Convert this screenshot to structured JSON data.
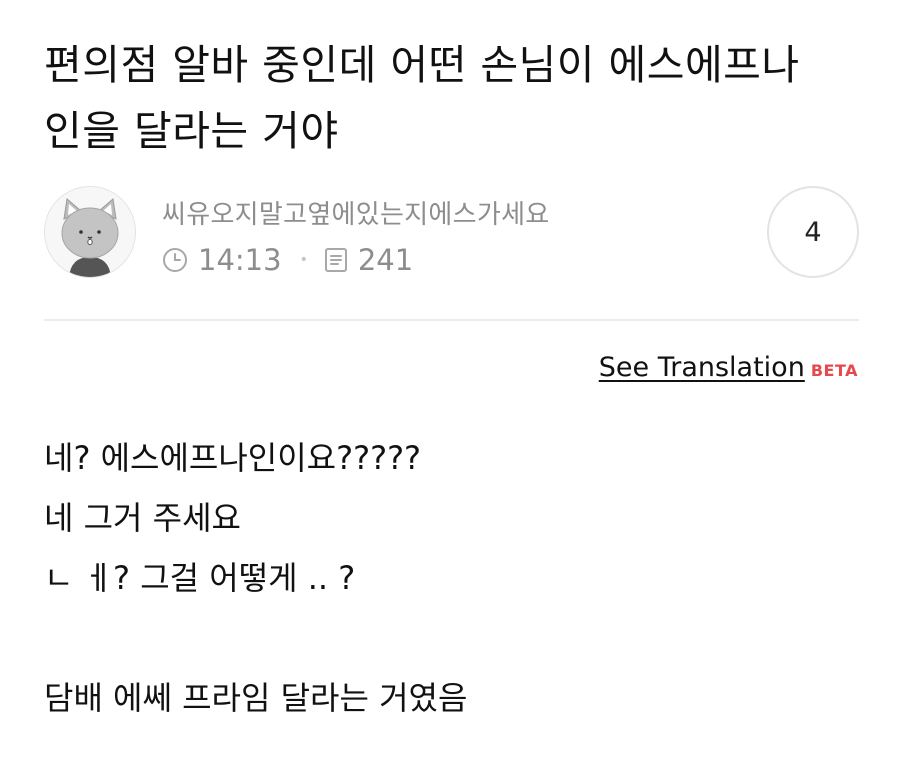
{
  "post": {
    "title": "편의점 알바 중인데 어떤 손님이 에스에프나\n인을 달라는 거야"
  },
  "author": {
    "nickname": "씨유오지말고옆에있는지에스가세요",
    "time": "14:13",
    "view_count": "241",
    "avatar_icon": "cat-avatar-icon"
  },
  "comments": {
    "count": "4"
  },
  "translation": {
    "link_label": "See Translation",
    "badge": "BETA",
    "badge_color": "#e5484d"
  },
  "body": {
    "lines": [
      "네? 에스에프나인이요?????",
      "네 그거 주세요",
      "ㄴ ㅔ? 그걸 어떻게 .. ?",
      "",
      "담배 에쎄 프라임 달라는 거였음"
    ]
  }
}
